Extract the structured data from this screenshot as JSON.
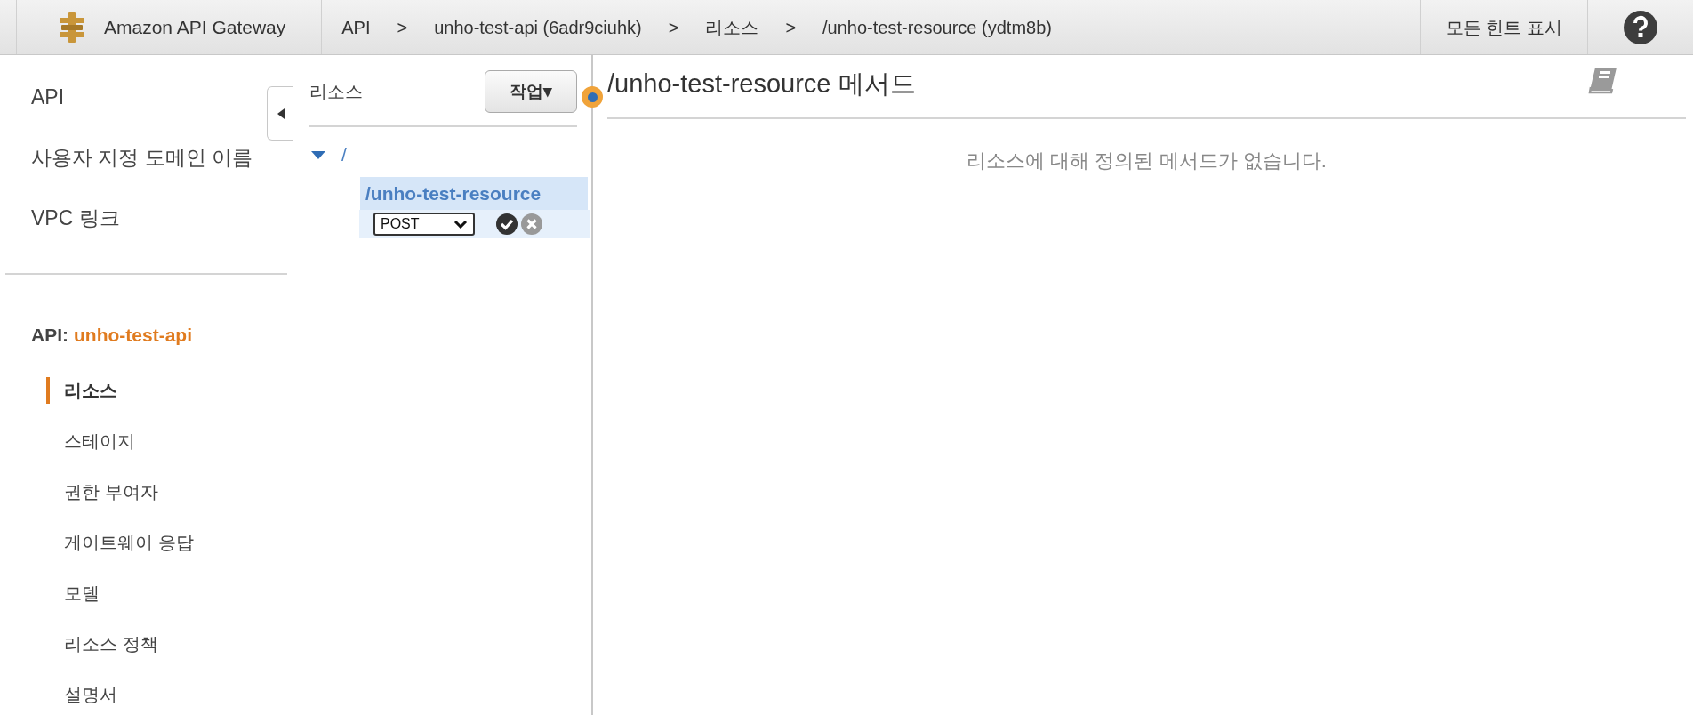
{
  "top_bar": {
    "product": "Amazon API Gateway",
    "breadcrumbs": [
      {
        "label": "API"
      },
      {
        "label": ">",
        "kind": "separator"
      },
      {
        "label": "unho-test-api (6adr9ciuhk)"
      },
      {
        "label": ">",
        "kind": "separator"
      },
      {
        "label": "리소스"
      },
      {
        "label": ">",
        "kind": "separator"
      },
      {
        "label": "/unho-test-resource (ydtm8b)"
      }
    ],
    "hints_button": "모든 힌트 표시"
  },
  "sidebar": {
    "items": [
      {
        "label": "API"
      },
      {
        "label": "사용자 지정 도메인 이름"
      },
      {
        "label": "VPC 링크"
      }
    ],
    "api_heading": {
      "prefix": "API:",
      "name": "unho-test-api"
    },
    "api_items": [
      {
        "label": "리소스",
        "selected": true
      },
      {
        "label": "스테이지",
        "selected": false
      },
      {
        "label": "권한 부여자",
        "selected": false
      },
      {
        "label": "게이트웨이 응답",
        "selected": false
      },
      {
        "label": "모델",
        "selected": false
      },
      {
        "label": "리소스 정책",
        "selected": false
      },
      {
        "label": "설명서",
        "selected": false
      }
    ]
  },
  "resource_tree": {
    "title": "리소스",
    "actions_button": "작업▾",
    "root": {
      "label": "/",
      "expanded": true,
      "selected": false,
      "children": [
        {
          "label": "/unho-test-resource",
          "selected": true
        }
      ]
    },
    "new_method": {
      "value": "POST"
    }
  },
  "main": {
    "title": "/unho-test-resource 메서드",
    "empty_message": "리소스에 대해 정의된 메서드가 없습니다."
  }
}
